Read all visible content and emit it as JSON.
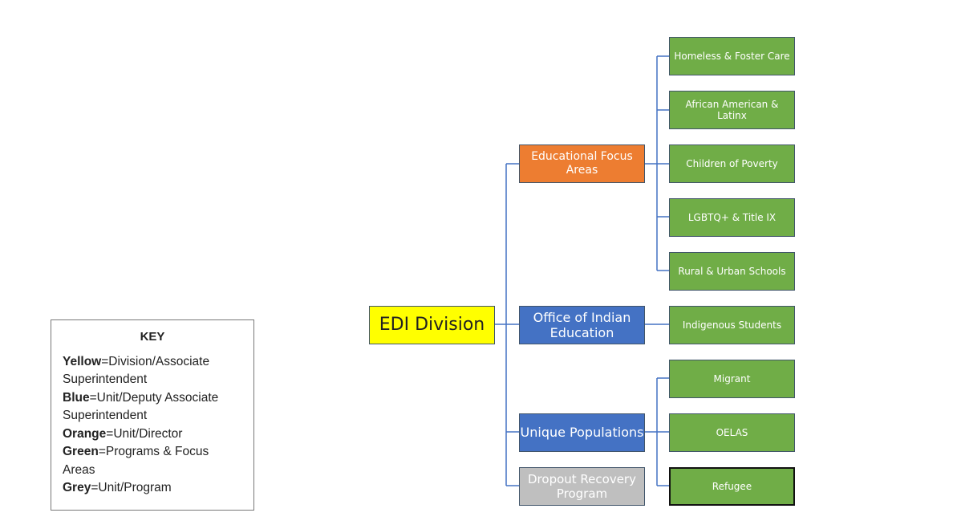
{
  "root": {
    "label": "EDI Division",
    "color": "#ffff00"
  },
  "units": [
    {
      "label": "Educational Focus Areas",
      "color": "#ed7d31",
      "children": [
        "Homeless & Foster Care",
        "African American & Latinx",
        "Children of Poverty",
        "LGBTQ+ & Title IX",
        "Rural & Urban Schools"
      ]
    },
    {
      "label": "Office of Indian Education",
      "color": "#4472c4",
      "children": [
        "Indigenous Students"
      ]
    },
    {
      "label": "Unique Populations",
      "color": "#4472c4",
      "children": [
        "Migrant",
        "OELAS",
        "Refugee"
      ]
    },
    {
      "label": "Dropout Recovery Program",
      "color": "#bfbfbf",
      "children": []
    }
  ],
  "program_color": "#70ad47",
  "key": {
    "title": "KEY",
    "entries": [
      {
        "term": "Yellow",
        "desc": "=Division/Associate Superintendent"
      },
      {
        "term": "Blue",
        "desc": "=Unit/Deputy Associate Superintendent"
      },
      {
        "term": "Orange",
        "desc": "=Unit/Director"
      },
      {
        "term": "Green",
        "desc": "=Programs & Focus Areas"
      },
      {
        "term": "Grey",
        "desc": "=Unit/Program"
      }
    ]
  }
}
